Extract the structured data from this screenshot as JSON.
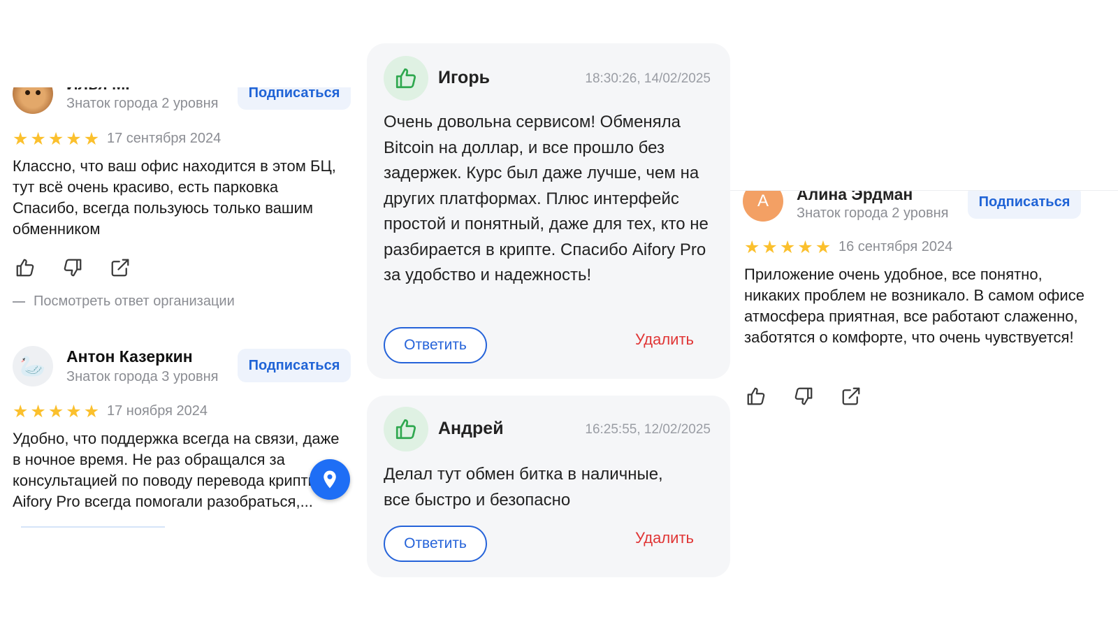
{
  "left_column": {
    "reviews": [
      {
        "author": "Илья М.",
        "level": "Знаток города 2 уровня",
        "subscribe_label": "Подписаться",
        "stars": 5,
        "date": "17 сентября 2024",
        "text": "Классно, что ваш офис находится в этом БЦ, тут всё очень красиво, есть парковка Спасибо, всегда пользуюсь только вашим обменником",
        "org_reply_label": "Посмотреть ответ организации"
      },
      {
        "author": "Антон Казеркин",
        "level": "Знаток города 3 уровня",
        "subscribe_label": "Подписаться",
        "stars": 5,
        "date": "17 ноября 2024",
        "text": "Удобно, что поддержка всегда на связи, даже в ночное время. Не раз обращался за консультацией по поводу перевода крипты, Aifory Pro всегда помогали разобраться,..."
      }
    ]
  },
  "middle_column": {
    "cards": [
      {
        "name": "Игорь",
        "time": "18:30:26, 14/02/2025",
        "text": "Очень довольна сервисом! Обменяла Bitcoin на доллар, и все прошло без задержек. Курс был даже лучше, чем на других платформах. Плюс интерфейс простой и понятный, даже для тех, кто не разбирается в крипте. Спасибо Aifory Pro за удобство и надежность!",
        "reply_label": "Ответить",
        "delete_label": "Удалить"
      },
      {
        "name": "Андрей",
        "time": "16:25:55, 12/02/2025",
        "text": "Делал тут обмен битка в наличные, все быстро и безопасно",
        "reply_label": "Ответить",
        "delete_label": "Удалить"
      }
    ]
  },
  "right_column": {
    "review": {
      "avatar_letter": "А",
      "author": "Алина Эрдман",
      "level": "Знаток города 2 уровня",
      "subscribe_label": "Подписаться",
      "stars": 5,
      "date": "16 сентября 2024",
      "text": "Приложение очень удобное, все понятно, никаких проблем не возникало. В самом офисе атмосфера приятная, все работают слаженно, заботятся о комфорте, что очень чувствуется!"
    }
  },
  "colors": {
    "accent_blue": "#1f63d6",
    "star_yellow": "#fbc02d",
    "delete_red": "#e03535",
    "like_green": "#2fa84f"
  }
}
